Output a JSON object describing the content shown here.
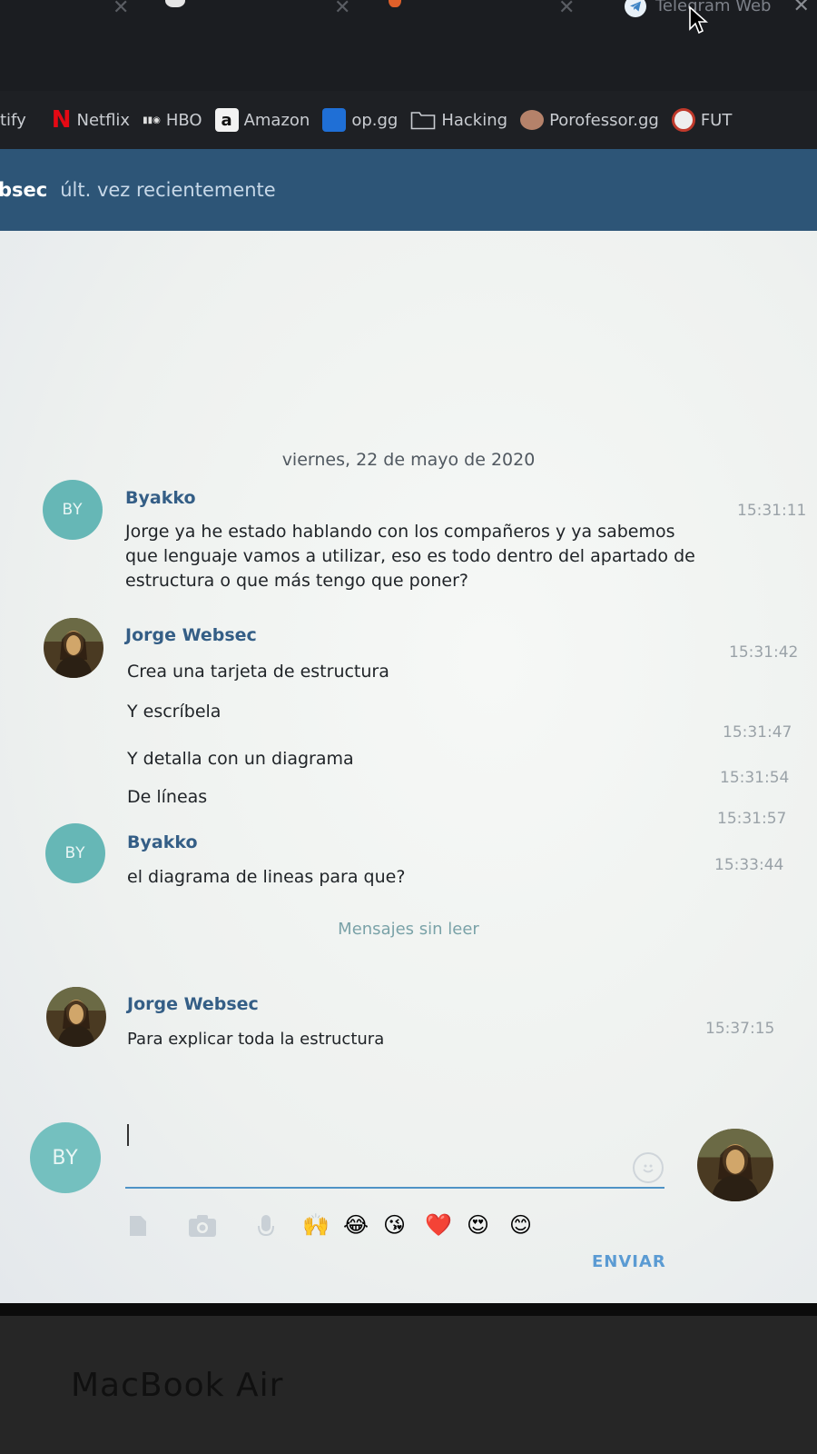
{
  "browser": {
    "active_tab_title": "Telegram Web",
    "close_glyph": "✕"
  },
  "bookmarks": [
    {
      "label": "tify",
      "icon": "spotify-icon"
    },
    {
      "label": "Netflix",
      "icon": "netflix-icon"
    },
    {
      "label": "HBO",
      "icon": "hbo-icon"
    },
    {
      "label": "Amazon",
      "icon": "amazon-icon"
    },
    {
      "label": "op.gg",
      "icon": "opgg-icon"
    },
    {
      "label": "Hacking",
      "icon": "folder-icon"
    },
    {
      "label": "Porofessor.gg",
      "icon": "porofessor-icon"
    },
    {
      "label": "FUT",
      "icon": "fut-icon"
    }
  ],
  "chat_header": {
    "name": "bsec",
    "status": "últ. vez recientemente"
  },
  "chat": {
    "date_separator": "viernes, 22 de mayo de 2020",
    "unread_label": "Mensajes sin leer",
    "avatar_initials": "BY",
    "messages": [
      {
        "author": "Byakko",
        "text_lines": [
          "Jorge ya he estado hablando con los compañeros y ya sabemos",
          "que lenguaje vamos a utilizar, eso es todo dentro del apartado de",
          "estructura o que más tengo que poner?"
        ],
        "time": "15:31:11"
      },
      {
        "author": "Jorge Websec",
        "text": "Crea una tarjeta de estructura",
        "time": "15:31:42"
      },
      {
        "text": "Y escríbela",
        "time": "15:31:47"
      },
      {
        "text": "Y detalla con un diagrama",
        "time": "15:31:54"
      },
      {
        "text": "De líneas",
        "time": "15:31:57"
      },
      {
        "author": "Byakko",
        "text": "el diagrama de lineas para que?",
        "time": "15:33:44"
      },
      {
        "author": "Jorge Websec",
        "text": "Para explicar toda la estructura",
        "time": "15:37:15"
      }
    ]
  },
  "composer": {
    "avatar_initials": "BY",
    "emojis": [
      "🙌",
      "😂",
      "😘",
      "❤️",
      "😍",
      "😊"
    ],
    "send_label": "ENVIAR"
  },
  "device": {
    "label": "MacBook Air"
  },
  "colors": {
    "header_bg": "#2d5577",
    "author_color": "#345e86",
    "avatar_teal": "#66b7b6",
    "send_color": "#5b9bd3"
  }
}
